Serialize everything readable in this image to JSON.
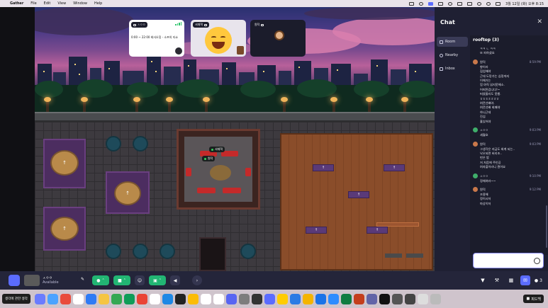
{
  "menubar": {
    "app_name": "Gather",
    "menus": [
      "File",
      "Edit",
      "View",
      "Window",
      "Help"
    ],
    "clock": "3월 12일 (화) 오후 8:15"
  },
  "video_tiles": [
    {
      "label": "ㅅㅇㅇ",
      "meeting_text": "0:00 ~ 22:00 회사오징 - 소프의 티쇼"
    },
    {
      "label": "서재혁"
    },
    {
      "label": "원덕"
    }
  ],
  "world": {
    "name_tags": [
      "서재혁",
      "원덕"
    ]
  },
  "chat": {
    "title": "Chat",
    "close_icon": "close-icon",
    "nav": [
      {
        "label": "Room",
        "icon": "room-icon"
      },
      {
        "label": "Nearby",
        "icon": "people-icon"
      },
      {
        "label": "Inbox",
        "icon": "inbox-icon"
      }
    ],
    "thread_title": "rooftop (3)",
    "preamble": [
      "ㅋㅋ ㄴ ㅋㅋ",
      "또 피하셨요"
    ],
    "messages": [
      {
        "author": "원덕",
        "time": "8:59 PM",
        "color": "#c9784a",
        "lines": [
          "향이라",
          "집업해야",
          "근데 도망가는 심정까지",
          "이해가는",
          "힘 야직 읽지못해소.",
          "어떠된겁니다!~",
          "떠였졸리도 못봤.",
          "ㅎㅎㅎㅎㅎㅎㅎ",
          "여깐선배야.",
          "여깐선배 회패야",
          "하니근데",
          "진심",
          "홀있어야"
        ]
      },
      {
        "author": "ㅅㅇㅇ",
        "time": "9:03 PM",
        "color": "#3fae6a",
        "lines": [
          "세월호"
        ]
      },
      {
        "author": "원덕",
        "time": "9:03 PM",
        "color": "#c9784a",
        "lines": [
          "그생각은 지금도 회계 되는..",
          "낙오되면 버리조..",
          "펀은 밤",
          "저 처음에 주인공",
          "여자플이라니 뭔어요"
        ]
      },
      {
        "author": "ㅅㅇㅇ",
        "time": "9:10 PM",
        "color": "#3fae6a",
        "lines": [
          "정해여라~~"
        ]
      },
      {
        "author": "원덕",
        "time": "9:12 PM",
        "color": "#c9784a",
        "lines": [
          "조용해",
          "정이시저",
          "마상이저"
        ]
      }
    ],
    "input_placeholder": ""
  },
  "toolbar": {
    "self_name": "ㅅㅇㅇ",
    "self_status": "Available",
    "people_count": "3"
  },
  "dock": {
    "notice": "생각에 관한 생각",
    "feedback": "피드백"
  },
  "colors": {
    "accent": "#5b6cff",
    "green": "#22b573",
    "panel": "#1f2033"
  }
}
